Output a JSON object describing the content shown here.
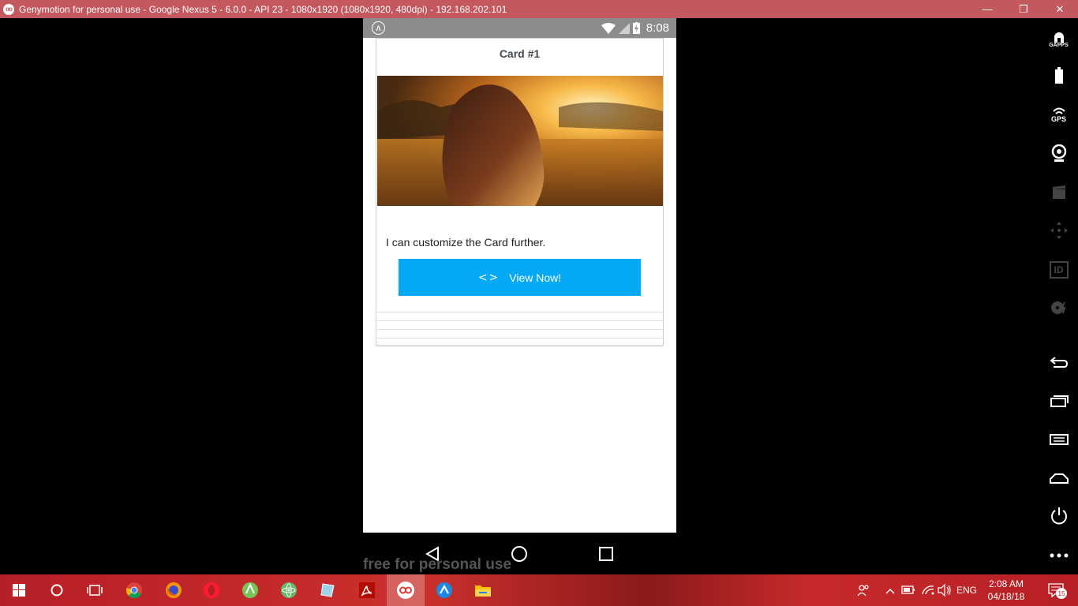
{
  "window": {
    "title": "Genymotion for personal use - Google Nexus 5 - 6.0.0 - API 23 - 1080x1920 (1080x1920, 480dpi) - 192.168.202.101",
    "logo_text": "oo",
    "minimize": "—",
    "maximize": "❐",
    "close": "✕"
  },
  "statusbar": {
    "notification_icon": "Λ",
    "time": "8:08"
  },
  "card": {
    "title": "Card #1",
    "text": "I can customize the Card further.",
    "button_icon": "<>",
    "button_label": "View Now!"
  },
  "watermark": "free for personal use",
  "sidebar": {
    "gapps_label": "GAPPS",
    "gps_label": "GPS",
    "id_label": "ID"
  },
  "tray": {
    "language": "ENG",
    "time": "2:08 AM",
    "date": "04/18/18",
    "notification_count": "15"
  },
  "colors": {
    "titlebar": "#c4585f",
    "button": "#03a9f4",
    "statusbar": "#8c8c8c"
  }
}
